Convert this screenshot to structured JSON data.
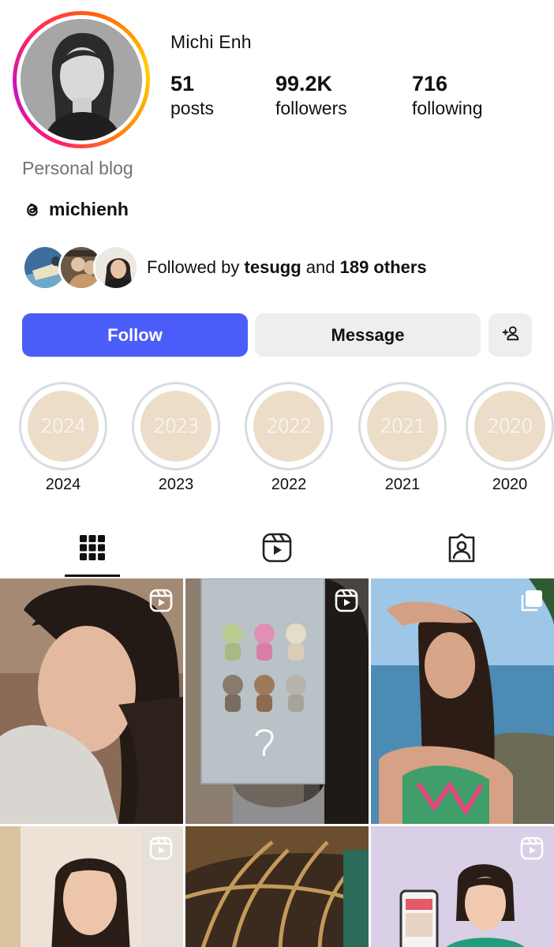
{
  "profile": {
    "username": "Michi Enh",
    "category": "Personal blog",
    "threads_handle": "michienh",
    "stats": {
      "posts": {
        "value": "51",
        "label": "posts"
      },
      "followers": {
        "value": "99.2K",
        "label": "followers"
      },
      "following": {
        "value": "716",
        "label": "following"
      }
    },
    "followed_by": {
      "prefix": "Followed by",
      "name": "tesugg",
      "conjunction": "and",
      "others": "189 others"
    }
  },
  "actions": {
    "follow_label": "Follow",
    "message_label": "Message",
    "add_user_icon": "add-user-icon"
  },
  "highlights": [
    {
      "cover_text": "2024",
      "label": "2024"
    },
    {
      "cover_text": "2023",
      "label": "2023"
    },
    {
      "cover_text": "2022",
      "label": "2022"
    },
    {
      "cover_text": "2021",
      "label": "2021"
    },
    {
      "cover_text": "2020",
      "label": "2020"
    }
  ],
  "tabs": [
    {
      "icon": "grid-icon",
      "active": true
    },
    {
      "icon": "reels-icon",
      "active": false
    },
    {
      "icon": "tagged-icon",
      "active": false
    }
  ],
  "posts": [
    {
      "type": "reel"
    },
    {
      "type": "reel"
    },
    {
      "type": "carousel"
    },
    {
      "type": "reel"
    },
    {
      "type": "image"
    },
    {
      "type": "reel"
    }
  ],
  "colors": {
    "follow_button": "#4a5df9",
    "secondary_button": "#eeeef1",
    "highlight_cover": "#ecdcc6",
    "muted_text": "#737373"
  }
}
